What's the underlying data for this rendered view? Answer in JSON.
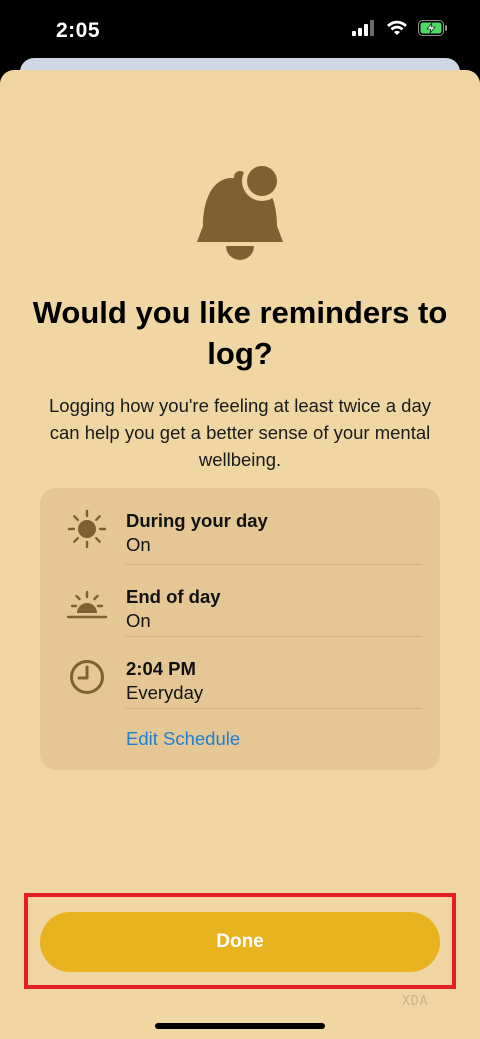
{
  "status_bar": {
    "time": "2:05"
  },
  "header": {
    "title": "Would you like reminders to log?",
    "subtitle": "Logging how you're feeling at least twice a day can help you get a better sense of your mental wellbeing."
  },
  "reminders": [
    {
      "title": "During your day",
      "value": "On",
      "icon": "sun-icon"
    },
    {
      "title": "End of day",
      "value": "On",
      "icon": "sunset-icon"
    },
    {
      "title": "2:04 PM",
      "value": "Everyday",
      "icon": "clock-icon"
    }
  ],
  "edit_schedule_label": "Edit Schedule",
  "done_label": "Done",
  "watermark": "XDA",
  "colors": {
    "sheet_background": "#efd6a3",
    "card_background": "#e4c795",
    "icon_brown": "#7d6133",
    "accent_yellow": "#e8b31f",
    "link_blue": "#1e7fd4",
    "highlight_red": "#e21f26"
  }
}
